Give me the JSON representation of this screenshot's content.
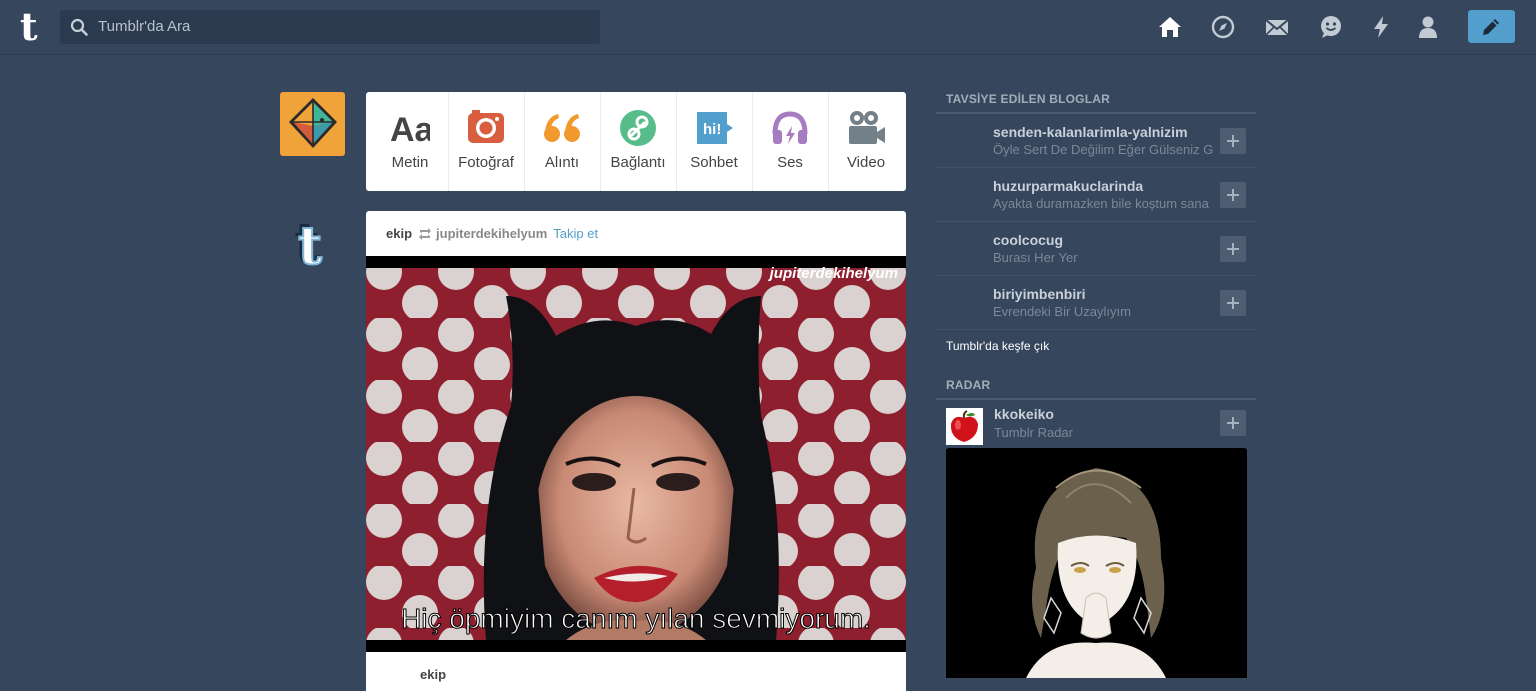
{
  "search": {
    "placeholder": "Tumblr'da Ara"
  },
  "nav_icons": [
    "home-icon",
    "compass-icon",
    "mail-icon",
    "messaging-icon",
    "lightning-icon",
    "account-icon"
  ],
  "post_types": [
    {
      "label": "Metin",
      "icon": "text-icon",
      "color": "#444444",
      "glyph": "Aa"
    },
    {
      "label": "Fotoğraf",
      "icon": "camera-icon",
      "color": "#d95e40"
    },
    {
      "label": "Alıntı",
      "icon": "quote-icon",
      "color": "#f2992e"
    },
    {
      "label": "Bağlantı",
      "icon": "link-icon",
      "color": "#56bc8a"
    },
    {
      "label": "Sohbet",
      "icon": "chat-icon",
      "color": "#529ecc",
      "glyph": "hi!"
    },
    {
      "label": "Ses",
      "icon": "headphones-icon",
      "color": "#a77dc2"
    },
    {
      "label": "Video",
      "icon": "video-camera-icon",
      "color": "#748089"
    }
  ],
  "post": {
    "author": "ekip",
    "reblogged_from": "jupiterdekihelyum",
    "follow_label": "Takip et",
    "image_watermark": "jupiterdekihelyum",
    "image_caption": "Hiç öpmiyim canım yılan sevmiyorum.",
    "footer_author": "ekip"
  },
  "sidebar": {
    "recommended_title": "TAVSİYE EDİLEN BLOGLAR",
    "blogs": [
      {
        "name": "senden-kalanlarimla-yalnizim",
        "desc": "Öyle Sert De Değilim Eğer Gülseniz G"
      },
      {
        "name": "huzurparmakuclarinda",
        "desc": "Ayakta duramazken bile koştum sana"
      },
      {
        "name": "coolcocug",
        "desc": "Burası Her Yer"
      },
      {
        "name": "biriyimbenbiri",
        "desc": "Evrendeki Bir Uzaylıyım"
      }
    ],
    "explore_label": "Tumblr'da keşfe çık",
    "radar_title": "RADAR",
    "radar": {
      "name": "kkokeiko",
      "subtitle": "Tumblr Radar"
    }
  },
  "colors": {
    "background": "#36465d",
    "accent": "#529ecc"
  }
}
